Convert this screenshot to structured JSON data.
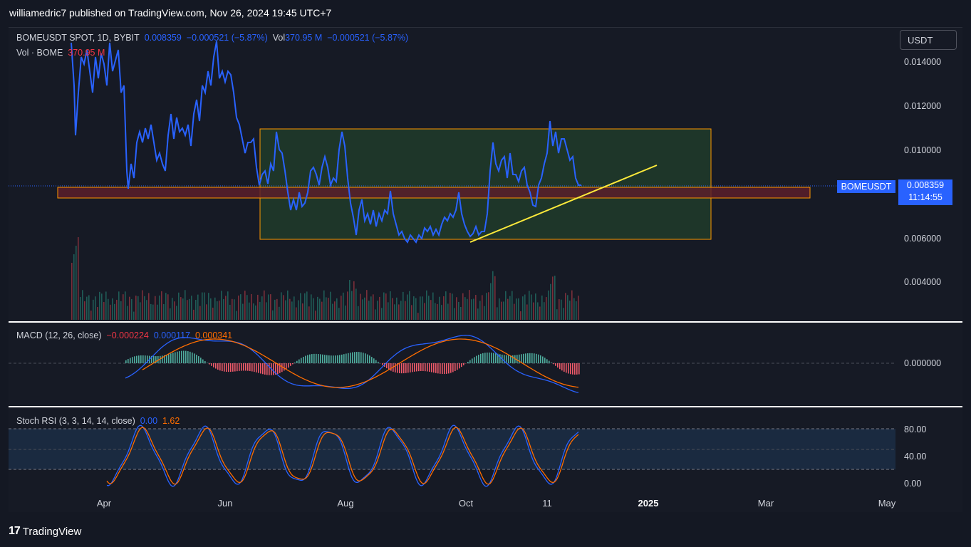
{
  "header": {
    "published": "williamedric7 published on TradingView.com, Nov 26, 2024 19:45 UTC+7"
  },
  "main_legend": {
    "symbol": "BOMEUSDT SPOT, 1D, BYBIT",
    "price": "0.008359",
    "change": "−0.000521 (−5.87%)",
    "vol_label": "Vol",
    "vol_value": "370.95 M",
    "vol_change": "−0.000521 (−5.87%)"
  },
  "vol_legend": {
    "label": "Vol · BOME",
    "value": "370.95 M"
  },
  "macd_legend": {
    "label": "MACD (12, 26, close)",
    "v1": "−0.000224",
    "v2": "0.000117",
    "v3": "0.000341"
  },
  "stoch_legend": {
    "label": "Stoch RSI (3, 3, 14, 14, close)",
    "k": "0.00",
    "d": "1.62"
  },
  "currency_button": "USDT",
  "price_axis": [
    "0.014000",
    "0.012000",
    "0.010000",
    "0.006000",
    "0.004000"
  ],
  "macd_axis": [
    "0.000000"
  ],
  "stoch_axis": [
    "80.00",
    "40.00",
    "0.00"
  ],
  "time_axis": [
    "Apr",
    "Jun",
    "Aug",
    "Oct",
    "11",
    "2025",
    "Mar",
    "May"
  ],
  "symbol_tag": "BOMEUSDT",
  "last_price": {
    "price": "0.008359",
    "countdown": "11:14:55"
  },
  "brand": {
    "name": "TradingView",
    "mark": "17"
  },
  "colors": {
    "price_line": "#2962ff",
    "macd_signal": "#ff6d00",
    "box_fill": "#1f3a2a",
    "box_border": "#ff9800",
    "support_band": "#5a1f2a",
    "trendline": "#ffeb3b"
  }
}
